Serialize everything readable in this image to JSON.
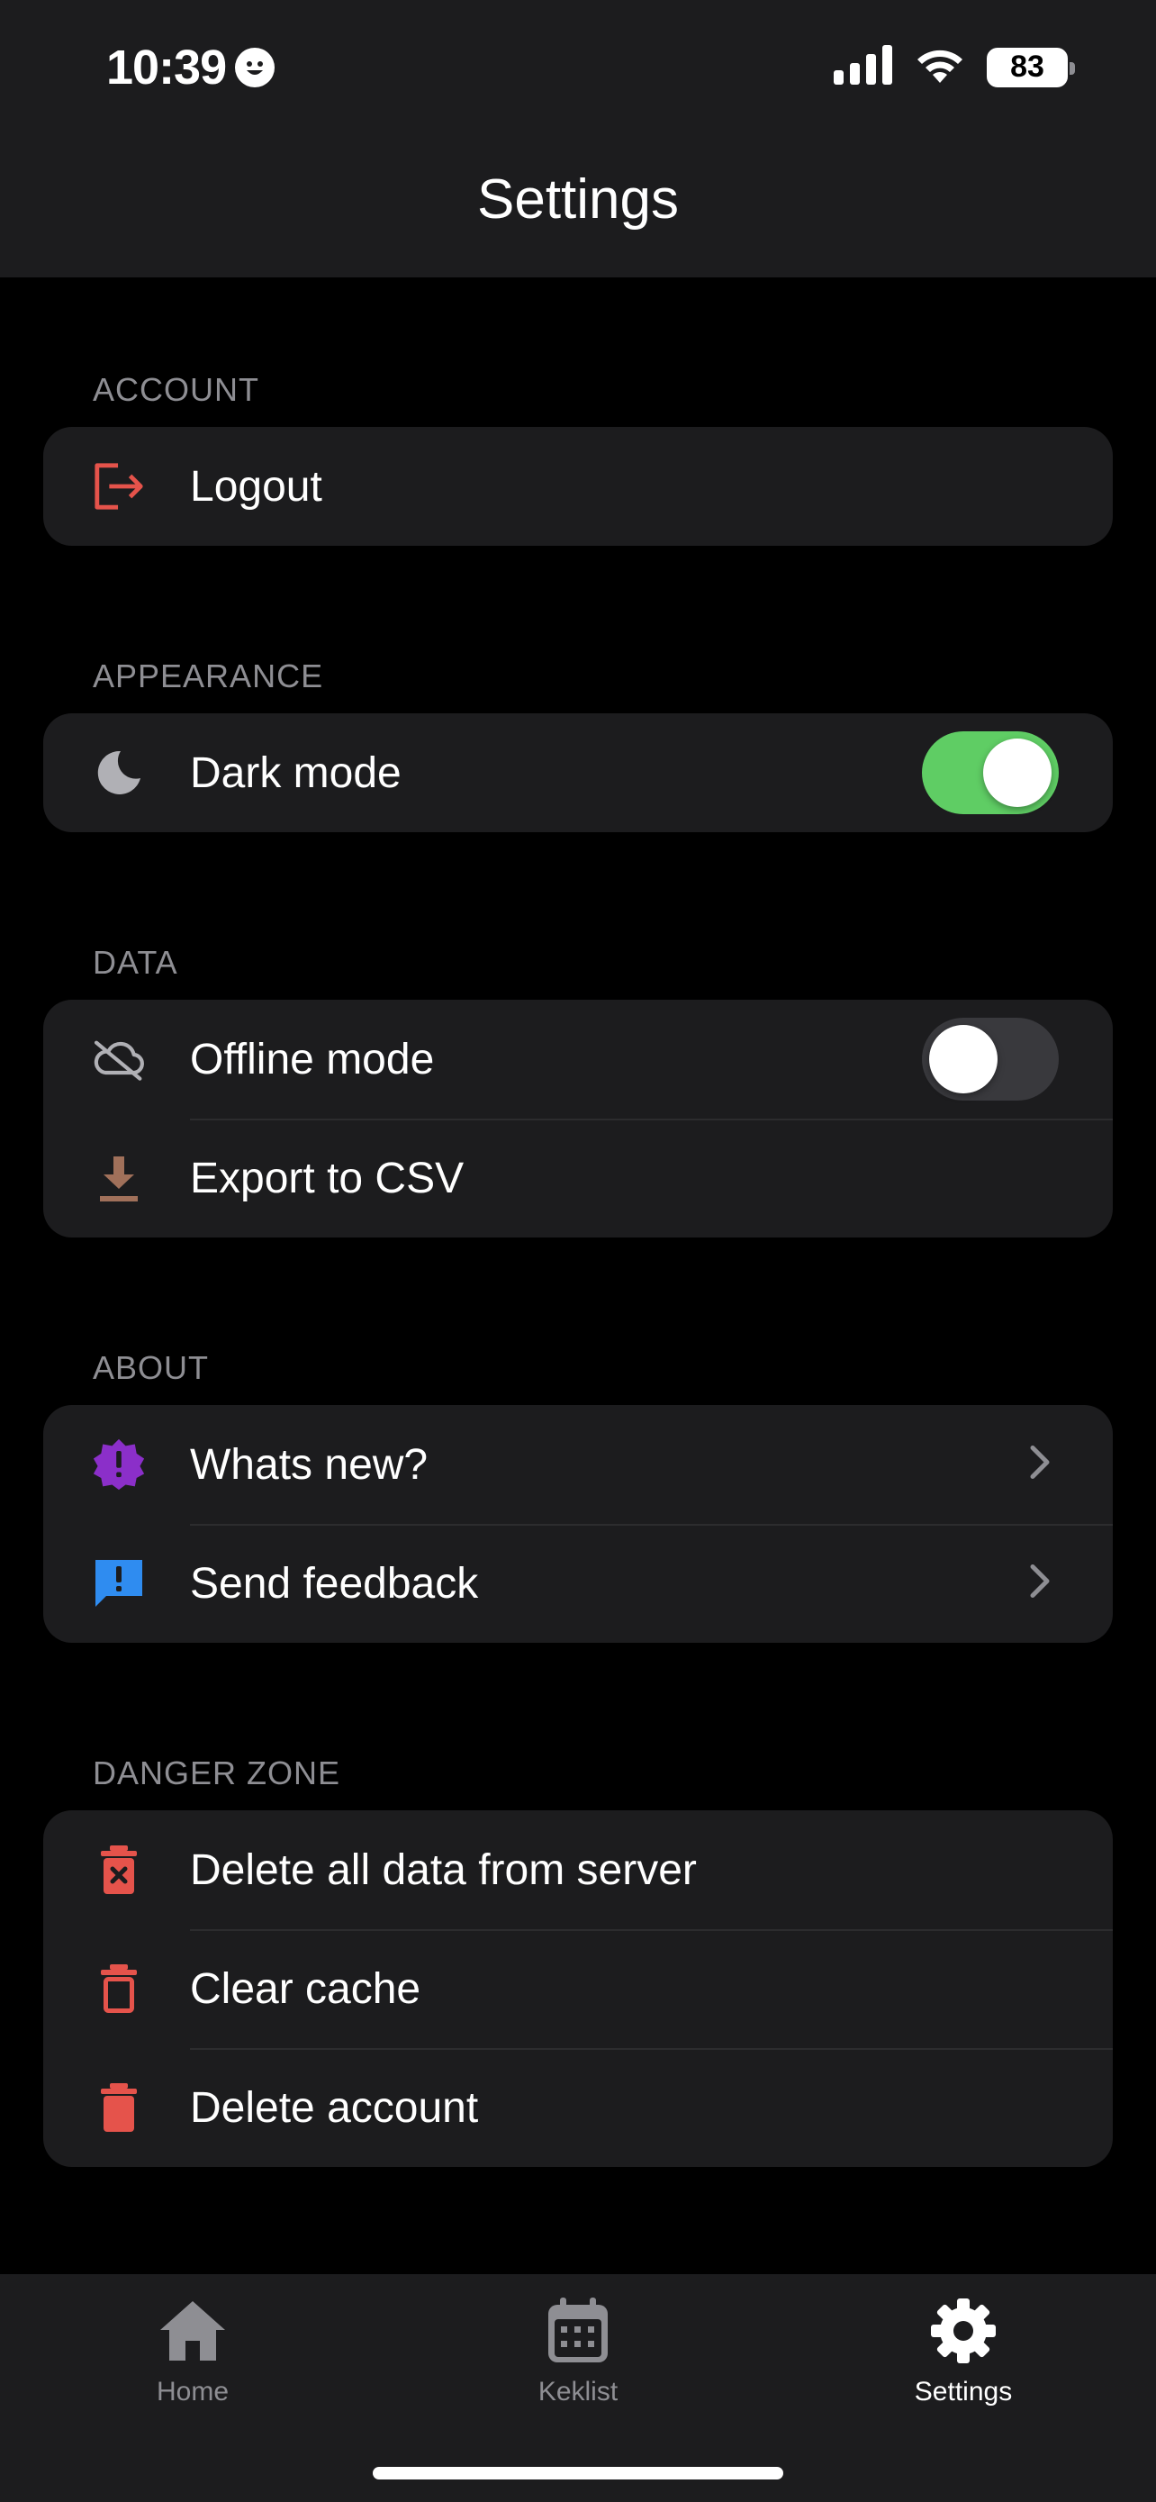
{
  "status_bar": {
    "time": "10:39",
    "battery": "83"
  },
  "header": {
    "title": "Settings"
  },
  "sections": {
    "account": {
      "label": "ACCOUNT",
      "logout": "Logout"
    },
    "appearance": {
      "label": "APPEARANCE",
      "dark_mode": "Dark mode",
      "dark_mode_on": true
    },
    "data": {
      "label": "DATA",
      "offline_mode": "Offline mode",
      "offline_mode_on": false,
      "export_csv": "Export to CSV"
    },
    "about": {
      "label": "ABOUT",
      "whats_new": "Whats new?",
      "send_feedback": "Send feedback"
    },
    "danger": {
      "label": "DANGER ZONE",
      "delete_server_data": "Delete all data from server",
      "clear_cache": "Clear cache",
      "delete_account": "Delete account"
    }
  },
  "tabbar": {
    "home": "Home",
    "keklist": "Keklist",
    "settings": "Settings",
    "active": "settings"
  },
  "colors": {
    "accent_green": "#5fcd64",
    "danger_red": "#e5534b",
    "purple": "#8b2fc9",
    "blue": "#2f8cf0",
    "export_brown": "#a0705a"
  },
  "icons": {
    "logout": "logout-icon",
    "dark_mode": "moon-icon",
    "offline": "cloud-off-icon",
    "export": "download-icon",
    "whats_new": "badge-alert-icon",
    "feedback": "feedback-icon",
    "delete_server": "trash-x-icon",
    "clear_cache": "trash-outline-icon",
    "delete_account": "trash-filled-icon"
  }
}
